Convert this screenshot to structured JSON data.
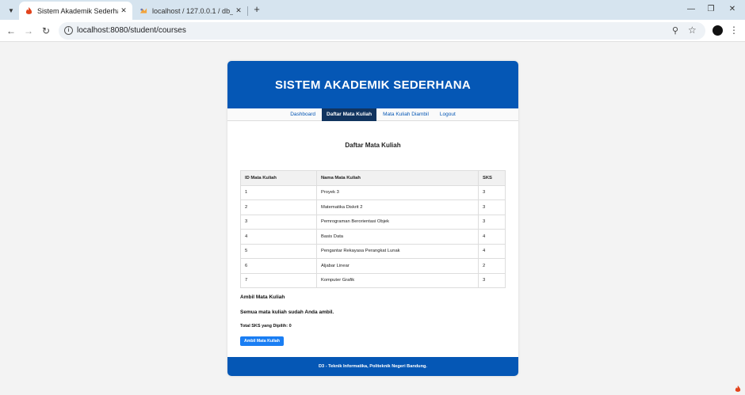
{
  "browser": {
    "tabs": [
      {
        "title": "Sistem Akademik Sederhana",
        "favicon": "flame-icon",
        "active": true
      },
      {
        "title": "localhost / 127.0.0.1 / db_akade",
        "favicon": "phpmyadmin-icon",
        "active": false
      }
    ],
    "url": "localhost:8080/student/courses"
  },
  "header": {
    "title": "SISTEM AKADEMIK SEDERHANA"
  },
  "nav": {
    "dashboard": "Dashboard",
    "courses": "Daftar Mata Kuliah",
    "taken": "Mata Kuliah Diambil",
    "logout": "Logout"
  },
  "page": {
    "title": "Daftar Mata Kuliah"
  },
  "table": {
    "headers": [
      "ID Mata Kuliah",
      "Nama Mata Kuliah",
      "SKS"
    ],
    "rows": [
      [
        "1",
        "Proyek 3",
        "3"
      ],
      [
        "2",
        "Matematika Diskrit 2",
        "3"
      ],
      [
        "3",
        "Pemrograman Berorientasi Objek",
        "3"
      ],
      [
        "4",
        "Basis Data",
        "4"
      ],
      [
        "5",
        "Pengantar Rekayasa Perangkat Lunak",
        "4"
      ],
      [
        "6",
        "Aljabar Linear",
        "2"
      ],
      [
        "7",
        "Komputer Grafik",
        "3"
      ]
    ]
  },
  "enroll": {
    "title": "Ambil Mata Kuliah",
    "message": "Semua mata kuliah sudah Anda ambil.",
    "total": "Total SKS yang Dipilih: 0",
    "button": "Ambil Mata Kuliah"
  },
  "footer": {
    "text": "D3 - Teknik Informatika, Politeknik Negeri Bandung."
  },
  "colors": {
    "primary": "#0557b5",
    "nav_active": "#11345f",
    "button": "#1a7ef3"
  }
}
